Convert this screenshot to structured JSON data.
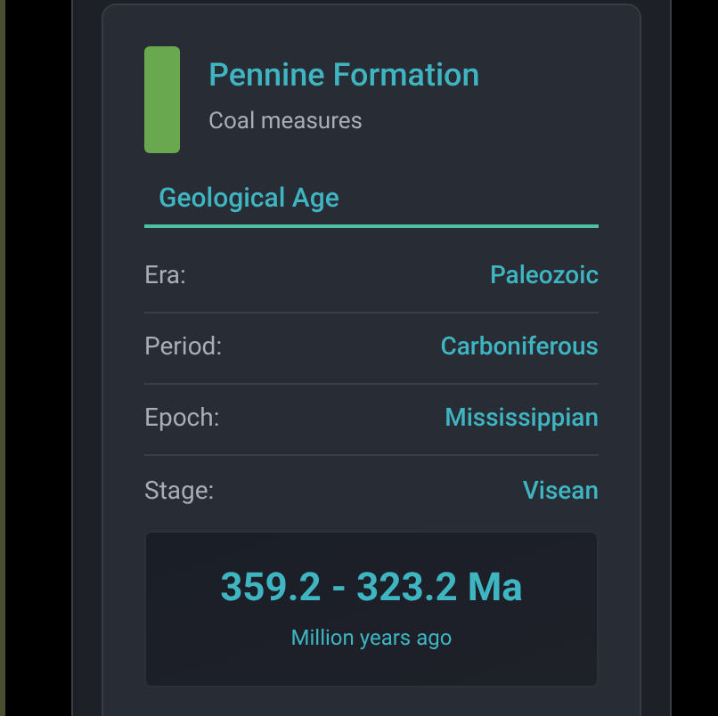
{
  "formation": {
    "name": "Pennine Formation",
    "description": "Coal measures",
    "color": "#6aa84f"
  },
  "section": {
    "title": "Geological Age"
  },
  "rows": [
    {
      "label": "Era:",
      "value": "Paleozoic"
    },
    {
      "label": "Period:",
      "value": "Carboniferous"
    },
    {
      "label": "Epoch:",
      "value": "Mississippian"
    },
    {
      "label": "Stage:",
      "value": "Visean"
    }
  ],
  "age_range": {
    "value": "359.2 - 323.2 Ma",
    "unit": "Million years ago"
  }
}
